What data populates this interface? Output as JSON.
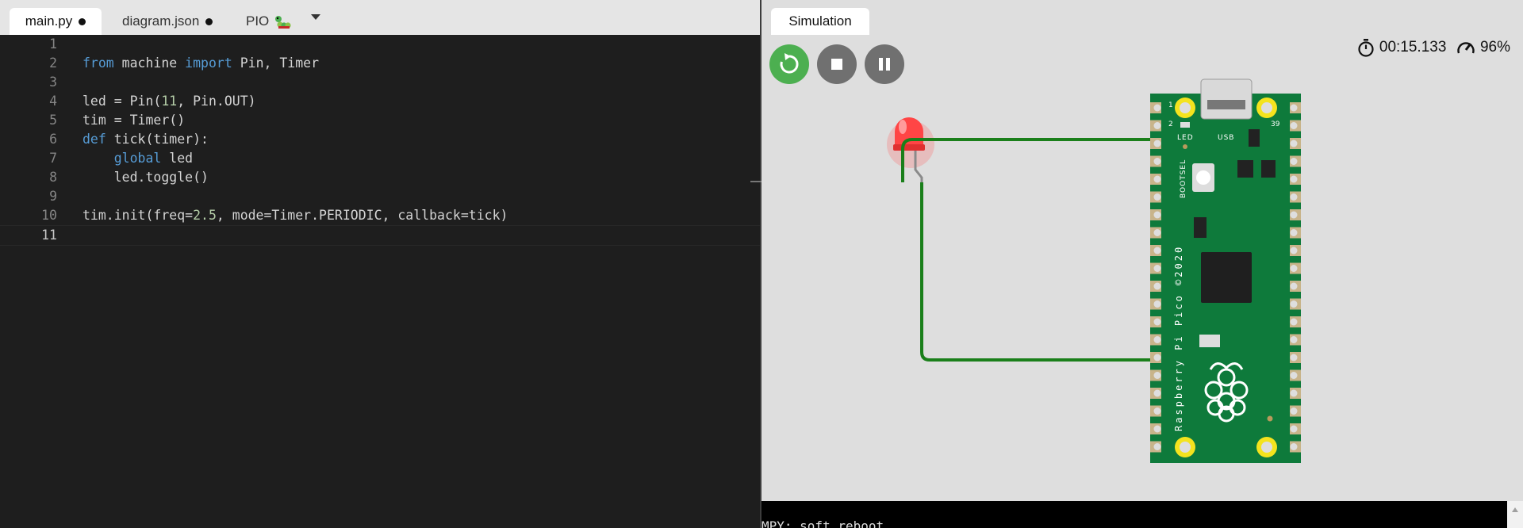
{
  "editor": {
    "tabs": [
      {
        "label": "main.py",
        "modified": true
      },
      {
        "label": "diagram.json",
        "modified": true
      },
      {
        "label": "PIO",
        "icon": "caterpillar-icon"
      }
    ],
    "more_icon": "chevron-down-icon",
    "current_line": 11,
    "lines": [
      {
        "n": "1",
        "tokens": []
      },
      {
        "n": "2",
        "tokens": [
          {
            "t": "from",
            "k": "kw"
          },
          {
            "t": " machine "
          },
          {
            "t": "import",
            "k": "kw"
          },
          {
            "t": " Pin, Timer"
          }
        ]
      },
      {
        "n": "3",
        "tokens": []
      },
      {
        "n": "4",
        "tokens": [
          {
            "t": "led = Pin("
          },
          {
            "t": "11",
            "k": "num"
          },
          {
            "t": ", Pin.OUT)"
          }
        ]
      },
      {
        "n": "5",
        "tokens": [
          {
            "t": "tim = Timer()"
          }
        ]
      },
      {
        "n": "6",
        "tokens": [
          {
            "t": "def",
            "k": "kw"
          },
          {
            "t": " tick(timer):"
          }
        ]
      },
      {
        "n": "7",
        "tokens": [
          {
            "t": "    "
          },
          {
            "t": "global",
            "k": "kw"
          },
          {
            "t": " led"
          }
        ]
      },
      {
        "n": "8",
        "tokens": [
          {
            "t": "    led.toggle()"
          }
        ]
      },
      {
        "n": "9",
        "tokens": []
      },
      {
        "n": "10",
        "tokens": [
          {
            "t": "tim.init(freq="
          },
          {
            "t": "2.5",
            "k": "num"
          },
          {
            "t": ", mode=Timer.PERIODIC, callback=tick)"
          }
        ]
      },
      {
        "n": "11",
        "tokens": []
      }
    ]
  },
  "simulation": {
    "tab_label": "Simulation",
    "controls": {
      "restart": "restart-icon",
      "stop": "stop-icon",
      "pause": "pause-icon"
    },
    "timer": "00:15.133",
    "speed": "96%",
    "console_text": "MPY: soft reboot",
    "board": {
      "name_label": "Raspberry Pi Pico ©2020",
      "led_label": "LED",
      "usb_label": "USB",
      "bootsel_label": "BOOTSEL",
      "pin1": "1",
      "pin2": "2",
      "pin39": "39"
    },
    "colors": {
      "wire": "#1a7f1a",
      "board": "#0e7a3b",
      "led": "#ff3b3b",
      "pad": "#f4e31e"
    }
  }
}
